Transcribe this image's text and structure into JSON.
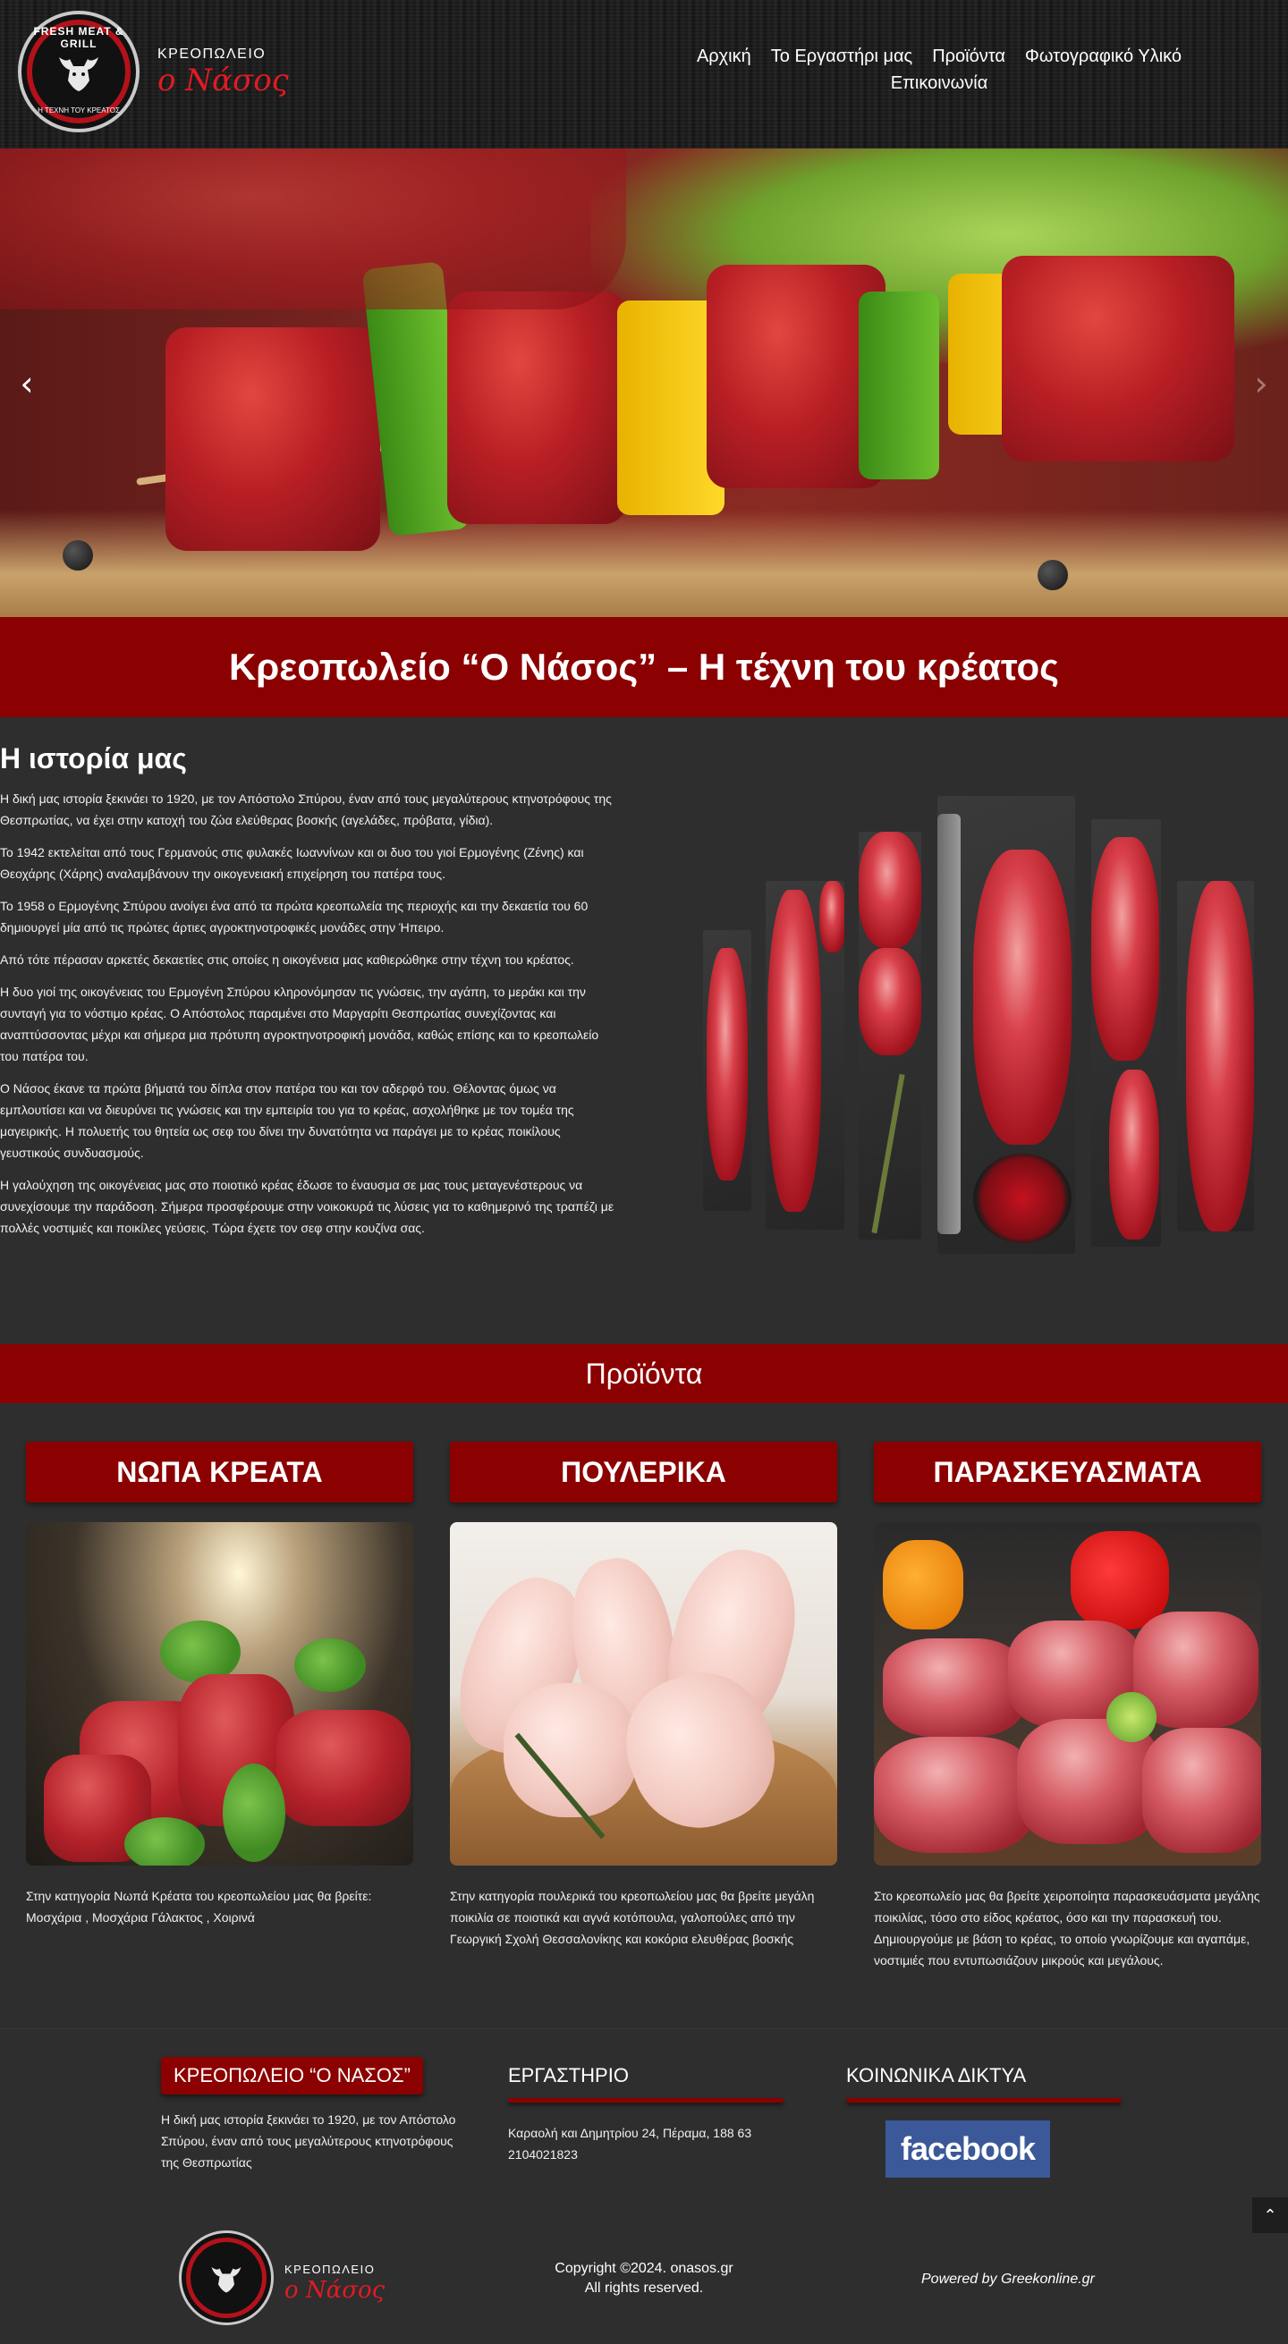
{
  "brand": {
    "top": "ΚΡΕΟΠΩΛΕΙΟ",
    "name": "ο Νάσος",
    "logo_arc_top": "FRESH MEAT & GRILL",
    "logo_arc_bottom": "Η ΤΕΧΝΗ ΤΟΥ ΚΡΕΑΤΟΣ"
  },
  "nav": {
    "items": [
      "Αρχική",
      "Το Εργαστήρι μας",
      "Προϊόντα",
      "Φωτογραφικό Υλικό",
      "Επικοινωνία"
    ]
  },
  "hero": {
    "prev_icon": "chevron-left-icon",
    "next_icon": "chevron-right-icon"
  },
  "title_band": "Κρεοπωλείο “Ο Νάσος” – Η τέχνη του κρέατος",
  "history": {
    "heading": "Η ιστορία μας",
    "paragraphs": [
      "Η δική μας ιστορία ξεκινάει το 1920, με τον Απόστολο Σπύρου, έναν από τους μεγαλύτερους κτηνοτρόφους της Θεσπρωτίας, να έχει στην κατοχή του ζώα ελεύθερας βοσκής (αγελάδες, πρόβατα, γίδια).",
      "Το 1942 εκτελείται από τους Γερμανούς στις φυλακές Ιωαννίνων και οι δυο του γιοί Ερμογένης (Ζένης) και Θεοχάρης (Χάρης) αναλαμβάνουν την οικογενειακή επιχείρηση του πατέρα τους.",
      "Το 1958 ο Ερμογένης Σπύρου ανοίγει ένα από τα πρώτα κρεοπωλεία της περιοχής και την δεκαετία του 60 δημιουργεί μία από τις πρώτες άρτιες αγροκτηνοτροφικές μονάδες στην Ήπειρο.",
      "Από τότε πέρασαν αρκετές δεκαετίες στις οποίες η οικογένεια μας καθιερώθηκε στην τέχνη του κρέατος.",
      "Η δυο γιοί της οικογένειας του Ερμογένη Σπύρου κληρονόμησαν τις γνώσεις, την αγάπη, το μεράκι και την συνταγή για το νόστιμο κρέας. Ο Απόστολος παραμένει στο Μαργαρίτι Θεσπρωτίας συνεχίζοντας και αναπτύσσοντας μέχρι και σήμερα μια πρότυπη αγροκτηνοτροφική μονάδα, καθώς επίσης και το κρεοπωλείο του πατέρα του.",
      "Ο Νάσος έκανε τα πρώτα βήματά του δίπλα στον πατέρα του και τον αδερφό του. Θέλοντας όμως να εμπλουτίσει και να διευρύνει τις γνώσεις και την εμπειρία του για το κρέας, ασχολήθηκε με τον τομέα της μαγειρικής. Η πολυετής του θητεία ως σεφ του δίνει την δυνατότητα να παράγει με το κρέας ποικίλους γευστικούς συνδυασμούς.",
      "Η γαλούχηση της οικογένειας μας στο ποιοτικό κρέας έδωσε το έναυσμα σε μας τους μεταγενέστερους να συνεχίσουμε την παράδοση. Σήμερα προσφέρουμε στην νοικοκυρά τις λύσεις για το καθημερινό της τραπέζι με πολλές νοστιμιές και ποικίλες γεύσεις. Τώρα έχετε τον σεφ στην κουζίνα σας."
    ]
  },
  "products": {
    "heading": "Προϊόντα",
    "cards": [
      {
        "title": "ΝΩΠΑ ΚΡΕΑΤΑ",
        "text": "Στην κατηγορία Νωπά Κρέατα του κρεοπωλείου μας θα βρείτε: Μοσχάρια , Μοσχάρια Γάλακτος , Χοιρινά"
      },
      {
        "title": "ΠΟΥΛΕΡΙΚΑ",
        "text": "Στην κατηγορία πουλερικά του κρεοπωλείου μας θα βρείτε μεγάλη ποικιλία σε ποιοτικά και αγνά κοτόπουλα, γαλοπούλες από την Γεωργική Σχολή Θεσσαλονίκης και κοκόρια ελευθέρας βοσκής"
      },
      {
        "title": "ΠΑΡΑΣΚΕΥΑΣΜΑΤΑ",
        "text": "Στο κρεοπωλείο μας θα βρείτε χειροποίητα παρασκευάσματα μεγάλης ποικιλίας, τόσο στο είδος κρέατος, όσο και την παρασκευή του. Δημιουργούμε με βάση το κρέας, το οποίο γνωρίζουμε και αγαπάμε, νοστιμιές που εντυπωσιάζουν μικρούς και μεγάλους."
      }
    ]
  },
  "footer": {
    "about_title": "ΚΡΕΟΠΩΛΕΙΟ “Ο ΝΑΣΟΣ”",
    "about_text": "Η δική μας ιστορία ξεκινάει το 1920, με τον Απόστολο Σπύρου, έναν από τους μεγαλύτερους κτηνοτρόφους της Θεσπρωτίας",
    "workshop_title": "ΕΡΓΑΣΤΗΡΙΟ",
    "address": "Καραολή και Δημητρίου 24, Πέραμα, 188 63",
    "phone": "2104021823",
    "social_title": "ΚΟΙΝΩΝΙΚΑ ΔΙΚΤΥΑ",
    "facebook_label": "facebook",
    "copyright_1": "Copyright ©2024. onasos.gr",
    "copyright_2": "All rights reserved.",
    "powered": "Powered by Greekonline.gr",
    "scroll_top_icon": "chevron-up-icon"
  },
  "colors": {
    "accent_red": "#8b0000",
    "background": "#2e2e2e",
    "facebook_blue": "#3b5998",
    "brand_red": "#e01b24"
  }
}
